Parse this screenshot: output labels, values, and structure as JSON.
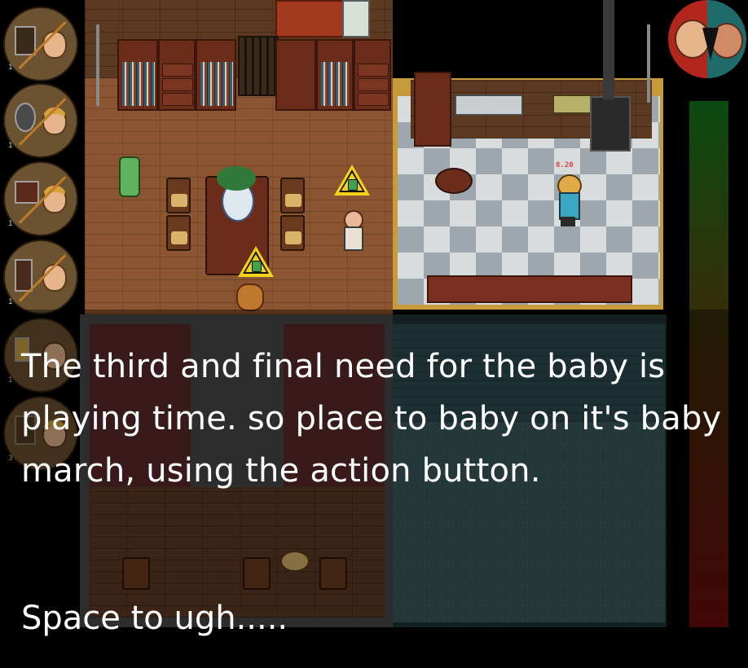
{
  "dialog": {
    "message": "The third and final need for the baby is playing time. so place to baby on it's baby march, using the action button.",
    "prompt": "Space to ugh....."
  },
  "hud": {
    "timer": "8.20",
    "slot_numbers": [
      "1",
      "1",
      "1",
      "1",
      "1",
      "3"
    ]
  },
  "meter": {
    "top_color": "#0b4a10",
    "bottom_color": "#6a0c0a"
  },
  "icons": {
    "need_slots": [
      "fireplace-icon",
      "mobile-toy-icon",
      "tv-icon",
      "grandfather-clock-icon",
      "lamp-icon",
      "unknown-icon"
    ],
    "warning": "warning-triangle-icon"
  }
}
